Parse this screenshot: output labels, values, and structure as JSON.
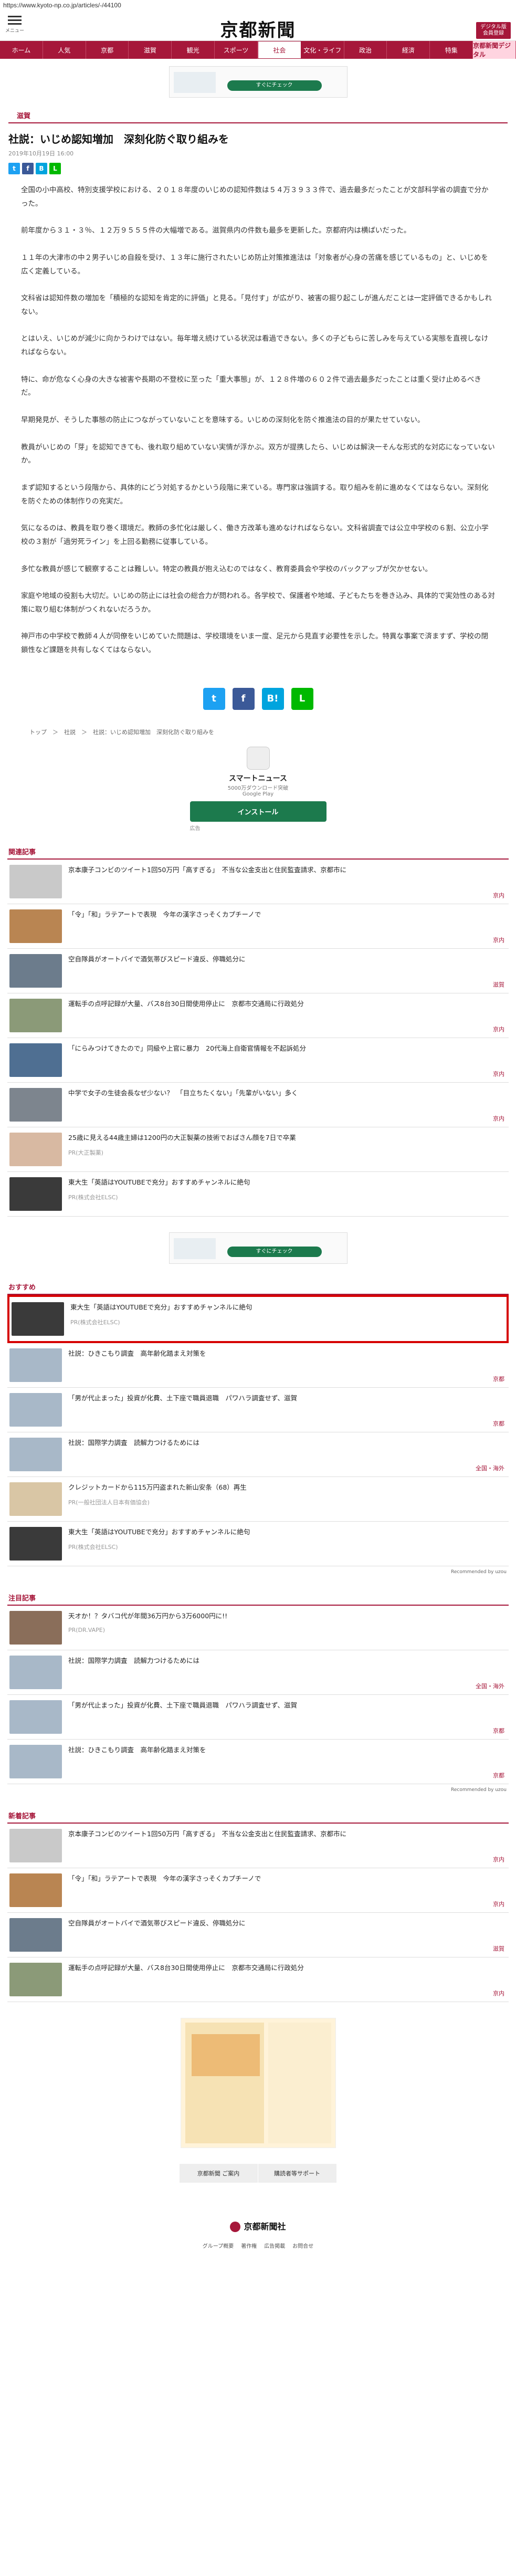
{
  "browser": {
    "url": "https://www.kyoto-np.co.jp/articles/-/44100"
  },
  "header": {
    "menu_label": "メニュー",
    "logo": "京都新聞",
    "right_btn": "デジタル版 会員登録"
  },
  "nav": [
    "ホーム",
    "人気",
    "京都",
    "滋賀",
    "観光",
    "スポーツ",
    "社会",
    "文化・ライフ",
    "政治",
    "経済",
    "特集",
    "京都新聞デジタル"
  ],
  "ad_top": {
    "btn": "すぐにチェック"
  },
  "article": {
    "category": "滋賀",
    "title": "社説：いじめ認知増加　深刻化防ぐ取り組みを",
    "date": "2019年10月19日 16:00",
    "paragraphs": [
      "全国の小中高校、特別支援学校における、２０１８年度のいじめの認知件数は５４万３９３３件で、過去最多だったことが文部科学省の調査で分かった。",
      "前年度から３１・３％、１２万９５５５件の大幅増である。滋賀県内の件数も最多を更新した。京都府内は横ばいだった。",
      "１１年の大津市の中２男子いじめ自殺を受け、１３年に施行されたいじめ防止対策推進法は「対象者が心身の苦痛を感じているもの」と、いじめを広く定義している。",
      "文科省は認知件数の増加を「積極的な認知を肯定的に評価」と見る。「見付す」が広がり、被害の掘り起こしが進んだことは一定評価できるかもしれない。",
      "とはいえ、いじめが減少に向かうわけではない。毎年増え続けている状況は看過できない。多くの子どもらに苦しみを与えている実態を直視しなければならない。",
      "特に、命が危なく心身の大きな被害や長期の不登校に至った「重大事態」が、１２８件増の６０２件で過去最多だったことは重く受け止めるべきだ。",
      "早期発見が、そうした事態の防止につながっていないことを意味する。いじめの深刻化を防ぐ推進法の目的が果たせていない。",
      "教員がいじめの「芽」を認知できても、後れ取り組めていない実情が浮かぶ。双方が提携したら、いじめは解決一そんな形式的な対応になっていないか。",
      "まず認知するという段階から、具体的にどう対処するかという段階に来ている。専門家は強調する。取り組みを前に進めなくてはならない。深刻化を防ぐための体制作りの充実だ。",
      "気になるのは、教員を取り巻く環境だ。教師の多忙化は厳しく、働き方改革も進めなければならない。文科省調査では公立中学校の６割、公立小学校の３割が「過労死ライン」を上回る勤務に従事している。",
      "多忙な教員が感じて観察することは難しい。特定の教員が抱え込むのではなく、教育委員会や学校のバックアップが欠かせない。",
      "家庭や地域の役割も大切だ。いじめの防止には社会の総合力が問われる。各学校で、保護者や地域、子どもたちを巻き込み、具体的で実効性のある対策に取り組む体制がつくれないだろうか。",
      "神戸市の中学校で教師４人が同僚をいじめていた問題は、学校環境をいま一度、足元から見直す必要性を示した。特異な事案で済ますず、学校の閉鎖性など課題を共有しなくてはならない。"
    ]
  },
  "breadcrumb": "トップ　＞　社説　＞　社説：いじめ認知増加　深刻化防ぐ取り組みを",
  "app": {
    "name": "スマートニュース",
    "desc": "5000万ダウンロード突破",
    "store": "Google Play",
    "btn": "インストール",
    "caption": "広告"
  },
  "related": {
    "heading": "関連記事",
    "items": [
      {
        "title": "京本康子コンビのツイート1回50万円「高すぎる」　不当な公金支出と住民監査請求、京都市に",
        "cat": "京内"
      },
      {
        "title": "「令」「和」ラテアートで表現　今年の漢字さっそくカプチーノで",
        "cat": "京内"
      },
      {
        "title": "空自隊員がオートバイで酒気帯びスピード違反、停職処分に",
        "cat": "滋賀"
      },
      {
        "title": "運転手の点呼記録が大量、バス8台30日間使用停止に　京都市交通局に行政処分",
        "cat": "京内"
      },
      {
        "title": "「にらみつけてきたので」同級や上官に暴力　20代海上自衛官情報を不起訴処分",
        "cat": "京内"
      },
      {
        "title": "中学で女子の生徒会長なぜ少ない？　「目立ちたくない」「先輩がいない」多く",
        "cat": "京内"
      },
      {
        "title": "25歳に見える44歳主婦は1200円の大正製薬の技術でおばさん顔を7日で卒業",
        "pr": "PR(大正製薬)",
        "cat": ""
      },
      {
        "title": "東大生「英語はYOUTUBEで充分」おすすめチャンネルに絶句",
        "pr": "PR(株式会社ELSC)",
        "cat": ""
      }
    ]
  },
  "ad_mid": {
    "btn": "すぐにチェック"
  },
  "recommend": {
    "heading": "おすすめ",
    "items": [
      {
        "title": "東大生「英語はYOUTUBEで充分」おすすめチャンネルに絶句",
        "pr": "PR(株式会社ELSC)",
        "cat": ""
      },
      {
        "title": "社説：ひきこもり調査　高年齢化踏まえ対策を",
        "cat": "京都"
      },
      {
        "title": "「男が代止まった」投資が化費、土下座で職員退職　パワハラ調査せず、滋賀",
        "cat": "京都"
      },
      {
        "title": "社説：国際学力調査　読解力つけるためには",
        "cat": "全国・海外"
      },
      {
        "title": "クレジットカードから115万円盗まれた新山安条（68）再生",
        "pr": "PR(一般社団法人日本有価協会)",
        "cat": ""
      },
      {
        "title": "東大生「英語はYOUTUBEで充分」おすすめチャンネルに絶句",
        "pr": "PR(株式会社ELSC)",
        "cat": ""
      }
    ],
    "powered": "Recommended by uzou"
  },
  "attention": {
    "heading": "注目記事",
    "items": [
      {
        "title": "天オか！？タバコ代が年間36万円から3万6000円に!!",
        "pr": "PR(DR.VAPE)",
        "cat": ""
      },
      {
        "title": "社説：国際学力調査　読解力つけるためには",
        "cat": "全国・海外"
      },
      {
        "title": "「男が代止まった」投資が化費、土下座で職員退職　パワハラ調査せず、滋賀",
        "cat": "京都"
      },
      {
        "title": "社説：ひきこもり調査　高年齢化踏まえ対策を",
        "cat": "京都"
      }
    ],
    "powered": "Recommended by uzou"
  },
  "latest": {
    "heading": "新着記事",
    "items": [
      {
        "title": "京本康子コンビのツイート1回50万円「高すぎる」　不当な公金支出と住民監査請求、京都市に",
        "cat": "京内"
      },
      {
        "title": "「令」「和」ラテアートで表現　今年の漢字さっそくカプチーノで",
        "cat": "京内"
      },
      {
        "title": "空自隊員がオートバイで酒気帯びスピード違反、停職処分に",
        "cat": "滋賀"
      },
      {
        "title": "運転手の点呼記録が大量、バス8台30日間使用停止に　京都市交通局に行政処分",
        "cat": "京内"
      }
    ]
  },
  "footer": {
    "links": [
      "京都新聞 ご案内",
      "購読者等サポート"
    ],
    "company": "京都新聞社",
    "menu": [
      "グループ概要",
      "著作権",
      "広告掲載",
      "お問合せ"
    ]
  }
}
